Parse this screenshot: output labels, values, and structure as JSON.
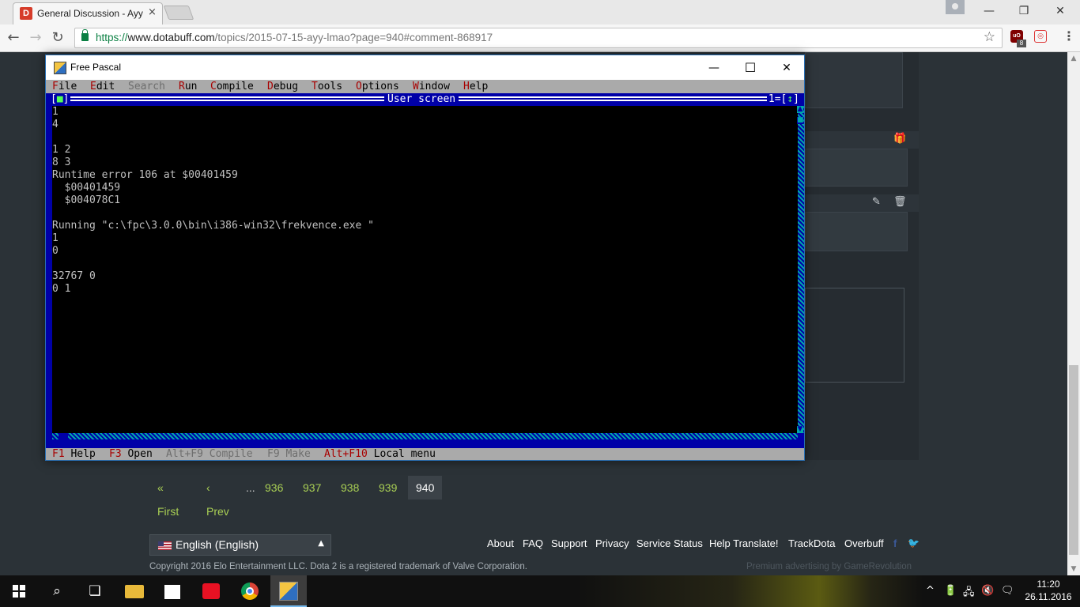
{
  "browser": {
    "tab_title": "General Discussion - Ayy",
    "tab_favicon": "D",
    "tab_close": "×",
    "url_scheme": "https://",
    "url_host": "www.dotabuff.com",
    "url_path": "/topics/2015-07-15-ayy-lmao?page=940#comment-868917",
    "back": "←",
    "forward": "→",
    "reload": "↻",
    "star": "☆",
    "ext_badge": "8",
    "ext_ublock": "uO",
    "menu": "⋮",
    "minimize": "—",
    "restore": "❐",
    "close": "✕"
  },
  "page": {
    "icons": {
      "gift": "gift-icon",
      "edit": "edit-icon",
      "trash": "trash-icon"
    },
    "gift_glyph": "🎁",
    "edit_glyph": "✎",
    "trash_glyph": "🗑",
    "pagination": {
      "first": "« First",
      "prev": "‹ Prev",
      "ellipsis": "...",
      "pages": [
        "936",
        "937",
        "938",
        "939"
      ],
      "current": "940"
    },
    "language": "English (English)",
    "language_arrow": "▲",
    "footer_links": [
      "About",
      "FAQ",
      "Support",
      "Privacy",
      "Service Status",
      "Help Translate!",
      "TrackDota",
      "Overbuff"
    ],
    "facebook": "f",
    "twitter": "🐦",
    "copyright": "Copyright 2016 Elo Entertainment LLC. Dota 2 is a registered trademark of Valve Corporation.",
    "ad_credit": "Premium advertising by GameRevolution",
    "colors": {
      "link": "#a9cf54",
      "background": "#2b3237"
    }
  },
  "freepascal": {
    "window_title": "Free Pascal",
    "minimize": "—",
    "maximize": "☐",
    "close": "✕",
    "menu": [
      {
        "hotkey": "F",
        "rest": "ile",
        "disabled": false
      },
      {
        "hotkey": "E",
        "rest": "dit",
        "disabled": false
      },
      {
        "hotkey": "S",
        "rest": "earch",
        "disabled": true
      },
      {
        "hotkey": "R",
        "rest": "un",
        "disabled": false
      },
      {
        "hotkey": "C",
        "rest": "ompile",
        "disabled": false
      },
      {
        "hotkey": "D",
        "rest": "ebug",
        "disabled": false
      },
      {
        "hotkey": "T",
        "rest": "ools",
        "disabled": false
      },
      {
        "hotkey": "O",
        "rest": "ptions",
        "disabled": false
      },
      {
        "hotkey": "W",
        "rest": "indow",
        "disabled": false
      },
      {
        "hotkey": "H",
        "rest": "elp",
        "disabled": false
      }
    ],
    "user_screen_title": "User screen",
    "window_number": "1",
    "close_box": "■",
    "zoom_box": "↕",
    "output_lines": [
      "1",
      "4",
      "",
      "1 2",
      "8 3",
      "Runtime error 106 at $00401459",
      "  $00401459",
      "  $004078C1",
      "",
      "Running \"c:\\fpc\\3.0.0\\bin\\i386-win32\\frekvence.exe \"",
      "1",
      "0",
      "",
      "32767 0",
      "0 1"
    ],
    "status": [
      {
        "key": "F1",
        "label": "Help",
        "disabled": false
      },
      {
        "key": "F3",
        "label": "Open",
        "disabled": false
      },
      {
        "key": "Alt+F9",
        "label": "Compile",
        "disabled": true
      },
      {
        "key": "F9",
        "label": "Make",
        "disabled": true
      },
      {
        "key": "Alt+F10",
        "label": "Local menu",
        "disabled": false
      }
    ],
    "colors": {
      "desktop": "#0000a8",
      "menubar": "#aaaaaa",
      "hotkey": "#a80000",
      "text": "#c0c0c0"
    }
  },
  "taskbar": {
    "search": "⌕",
    "task_view": "❏",
    "tray_up": "^",
    "tray_battery": "🔋",
    "tray_network": "🖧",
    "tray_sound": "🔇",
    "tray_notifications": "🗨",
    "time": "11:20",
    "date": "26.11.2016"
  }
}
